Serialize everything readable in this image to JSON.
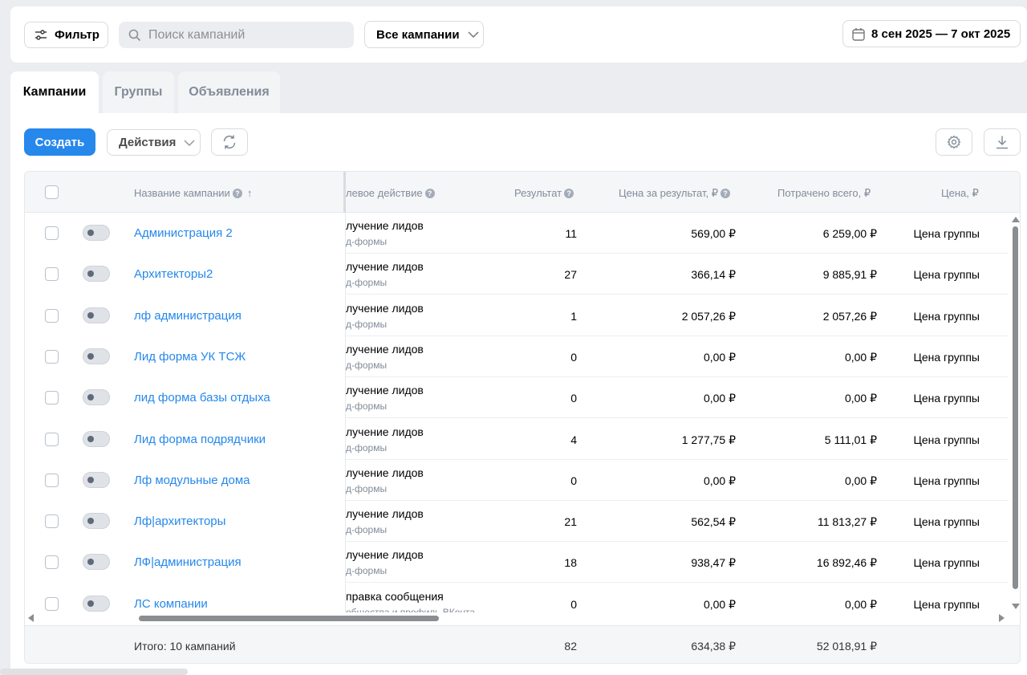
{
  "toolbar": {
    "filter_label": "Фильтр",
    "search_placeholder": "Поиск кампаний",
    "campaign_select": "Все кампании",
    "date_range": "8 сен 2025 — 7 окт 2025"
  },
  "tabs": [
    {
      "label": "Кампании",
      "active": true
    },
    {
      "label": "Группы",
      "active": false
    },
    {
      "label": "Объявления",
      "active": false
    }
  ],
  "actions": {
    "create_label": "Создать",
    "actions_label": "Действия"
  },
  "table": {
    "headers": {
      "name": "Название кампании",
      "sort_marker": "↑",
      "goal": "левое действие",
      "result": "Результат",
      "cost_per_result": "Цена за результат, ₽",
      "spent": "Потрачено всего, ₽",
      "price": "Цена, ₽"
    },
    "rows": [
      {
        "name": "Администрация 2",
        "goal": "лучение лидов",
        "goal_sub": "д-формы",
        "result": "11",
        "cpr": "569,00 ₽",
        "spent": "6 259,00 ₽",
        "price": "Цена группы"
      },
      {
        "name": "Архитекторы2",
        "goal": "лучение лидов",
        "goal_sub": "д-формы",
        "result": "27",
        "cpr": "366,14 ₽",
        "spent": "9 885,91 ₽",
        "price": "Цена группы"
      },
      {
        "name": "лф администрация",
        "goal": "лучение лидов",
        "goal_sub": "д-формы",
        "result": "1",
        "cpr": "2 057,26 ₽",
        "spent": "2 057,26 ₽",
        "price": "Цена группы"
      },
      {
        "name": "Лид форма УК ТСЖ",
        "goal": "лучение лидов",
        "goal_sub": "д-формы",
        "result": "0",
        "cpr": "0,00 ₽",
        "spent": "0,00 ₽",
        "price": "Цена группы"
      },
      {
        "name": "лид форма базы отдыха",
        "goal": "лучение лидов",
        "goal_sub": "д-формы",
        "result": "0",
        "cpr": "0,00 ₽",
        "spent": "0,00 ₽",
        "price": "Цена группы"
      },
      {
        "name": "Лид форма подрядчики",
        "goal": "лучение лидов",
        "goal_sub": "д-формы",
        "result": "4",
        "cpr": "1 277,75 ₽",
        "spent": "5 111,01 ₽",
        "price": "Цена группы"
      },
      {
        "name": "Лф модульные дома",
        "goal": "лучение лидов",
        "goal_sub": "д-формы",
        "result": "0",
        "cpr": "0,00 ₽",
        "spent": "0,00 ₽",
        "price": "Цена группы"
      },
      {
        "name": "Лф|архитекторы",
        "goal": "лучение лидов",
        "goal_sub": "д-формы",
        "result": "21",
        "cpr": "562,54 ₽",
        "spent": "11 813,27 ₽",
        "price": "Цена группы"
      },
      {
        "name": "ЛФ|администрация",
        "goal": "лучение лидов",
        "goal_sub": "д-формы",
        "result": "18",
        "cpr": "938,47 ₽",
        "spent": "16 892,46 ₽",
        "price": "Цена группы"
      },
      {
        "name": "ЛС компании",
        "goal": "правка сообщения",
        "goal_sub": "общества и профиль ВКонта",
        "result": "0",
        "cpr": "0,00 ₽",
        "spent": "0,00 ₽",
        "price": "Цена группы"
      }
    ],
    "footer": {
      "total_label": "Итого: 10 кампаний",
      "result": "82",
      "cpr": "634,38 ₽",
      "spent": "52 018,91 ₽"
    }
  },
  "colors": {
    "accent": "#2688eb",
    "muted": "#818c99",
    "background": "#ebedf0"
  }
}
